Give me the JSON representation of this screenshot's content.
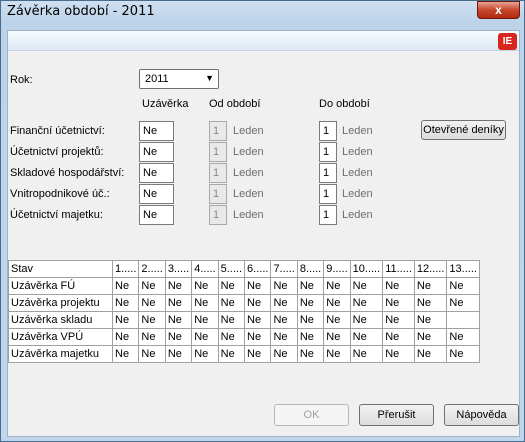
{
  "window": {
    "title": "Závěrka období - 2011",
    "close": "x"
  },
  "logo": "IE",
  "rok": {
    "label": "Rok:",
    "value": "2011"
  },
  "headers": {
    "uzaverka": "Uzávěrka",
    "od": "Od období",
    "do": "Do období"
  },
  "rows": [
    {
      "label": "Finanční účetnictví:",
      "uzaverka": "Ne",
      "od_num": "1",
      "od_month": "Leden",
      "do_num": "1",
      "do_month": "Leden"
    },
    {
      "label": "Účetnictví projektů:",
      "uzaverka": "Ne",
      "od_num": "1",
      "od_month": "Leden",
      "do_num": "1",
      "do_month": "Leden"
    },
    {
      "label": "Skladové hospodářství:",
      "uzaverka": "Ne",
      "od_num": "1",
      "od_month": "Leden",
      "do_num": "1",
      "do_month": "Leden"
    },
    {
      "label": "Vnitropodnikové úč.:",
      "uzaverka": "Ne",
      "od_num": "1",
      "od_month": "Leden",
      "do_num": "1",
      "do_month": "Leden"
    },
    {
      "label": "Účetnictví majetku:",
      "uzaverka": "Ne",
      "od_num": "1",
      "od_month": "Leden",
      "do_num": "1",
      "do_month": "Leden"
    }
  ],
  "open_journals_button": "Otevřené deníky",
  "table": {
    "columns": [
      "Stav",
      "1.....",
      "2.....",
      "3.....",
      "4.....",
      "5.....",
      "6.....",
      "7.....",
      "8.....",
      "9.....",
      "10.....",
      "11.....",
      "12.....",
      "13....."
    ],
    "rows": [
      [
        "Uzávěrka FÚ",
        "Ne",
        "Ne",
        "Ne",
        "Ne",
        "Ne",
        "Ne",
        "Ne",
        "Ne",
        "Ne",
        "Ne",
        "Ne",
        "Ne",
        "Ne"
      ],
      [
        "Uzávěrka projektu",
        "Ne",
        "Ne",
        "Ne",
        "Ne",
        "Ne",
        "Ne",
        "Ne",
        "Ne",
        "Ne",
        "Ne",
        "Ne",
        "Ne",
        "Ne"
      ],
      [
        "Uzávěrka skladu",
        "Ne",
        "Ne",
        "Ne",
        "Ne",
        "Ne",
        "Ne",
        "Ne",
        "Ne",
        "Ne",
        "Ne",
        "Ne",
        "Ne",
        ""
      ],
      [
        "Uzávěrka VPÚ",
        "Ne",
        "Ne",
        "Ne",
        "Ne",
        "Ne",
        "Ne",
        "Ne",
        "Ne",
        "Ne",
        "Ne",
        "Ne",
        "Ne",
        "Ne"
      ],
      [
        "Uzávěrka majetku",
        "Ne",
        "Ne",
        "Ne",
        "Ne",
        "Ne",
        "Ne",
        "Ne",
        "Ne",
        "Ne",
        "Ne",
        "Ne",
        "Ne",
        "Ne"
      ]
    ]
  },
  "buttons": {
    "ok": "OK",
    "cancel": "Přerušit",
    "help": "Nápověda"
  }
}
